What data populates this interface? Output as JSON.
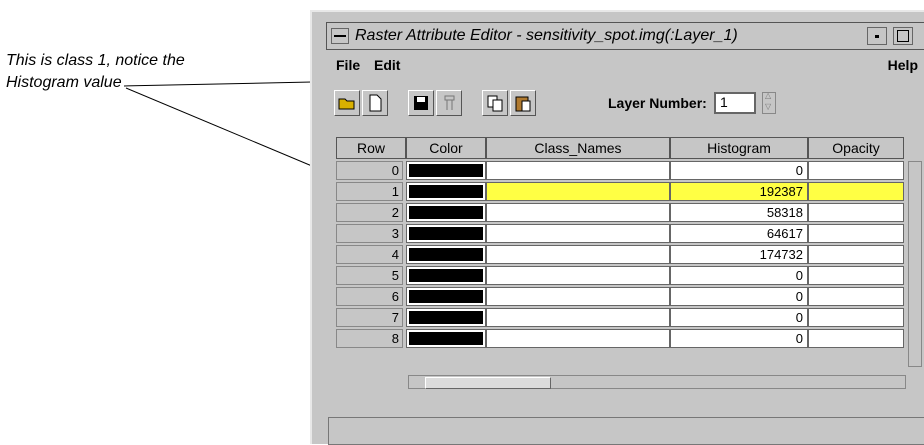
{
  "callout": {
    "line1": "This is class 1, notice the",
    "line2": "Histogram value"
  },
  "window": {
    "title": "Raster Attribute Editor - sensitivity_spot.img(:Layer_1)",
    "menu": {
      "file": "File",
      "edit": "Edit",
      "help": "Help"
    },
    "toolbar": {
      "icons": [
        "open-folder-icon",
        "new-file-icon",
        "save-icon",
        "criteria-icon",
        "copy-icon",
        "paste-icon"
      ],
      "layer_label": "Layer Number:",
      "layer_value": "1"
    },
    "table": {
      "headers": [
        "Row",
        "Color",
        "Class_Names",
        "Histogram",
        "Opacity"
      ],
      "rows": [
        {
          "row": "0",
          "histogram": "0"
        },
        {
          "row": "1",
          "histogram": "192387",
          "selected": true
        },
        {
          "row": "2",
          "histogram": "58318"
        },
        {
          "row": "3",
          "histogram": "64617"
        },
        {
          "row": "4",
          "histogram": "174732"
        },
        {
          "row": "5",
          "histogram": "0"
        },
        {
          "row": "6",
          "histogram": "0"
        },
        {
          "row": "7",
          "histogram": "0"
        },
        {
          "row": "8",
          "histogram": "0"
        }
      ]
    },
    "colors": {
      "swatch": "#000000",
      "selected": "#ffff44",
      "chrome": "#c6c6c6"
    }
  }
}
